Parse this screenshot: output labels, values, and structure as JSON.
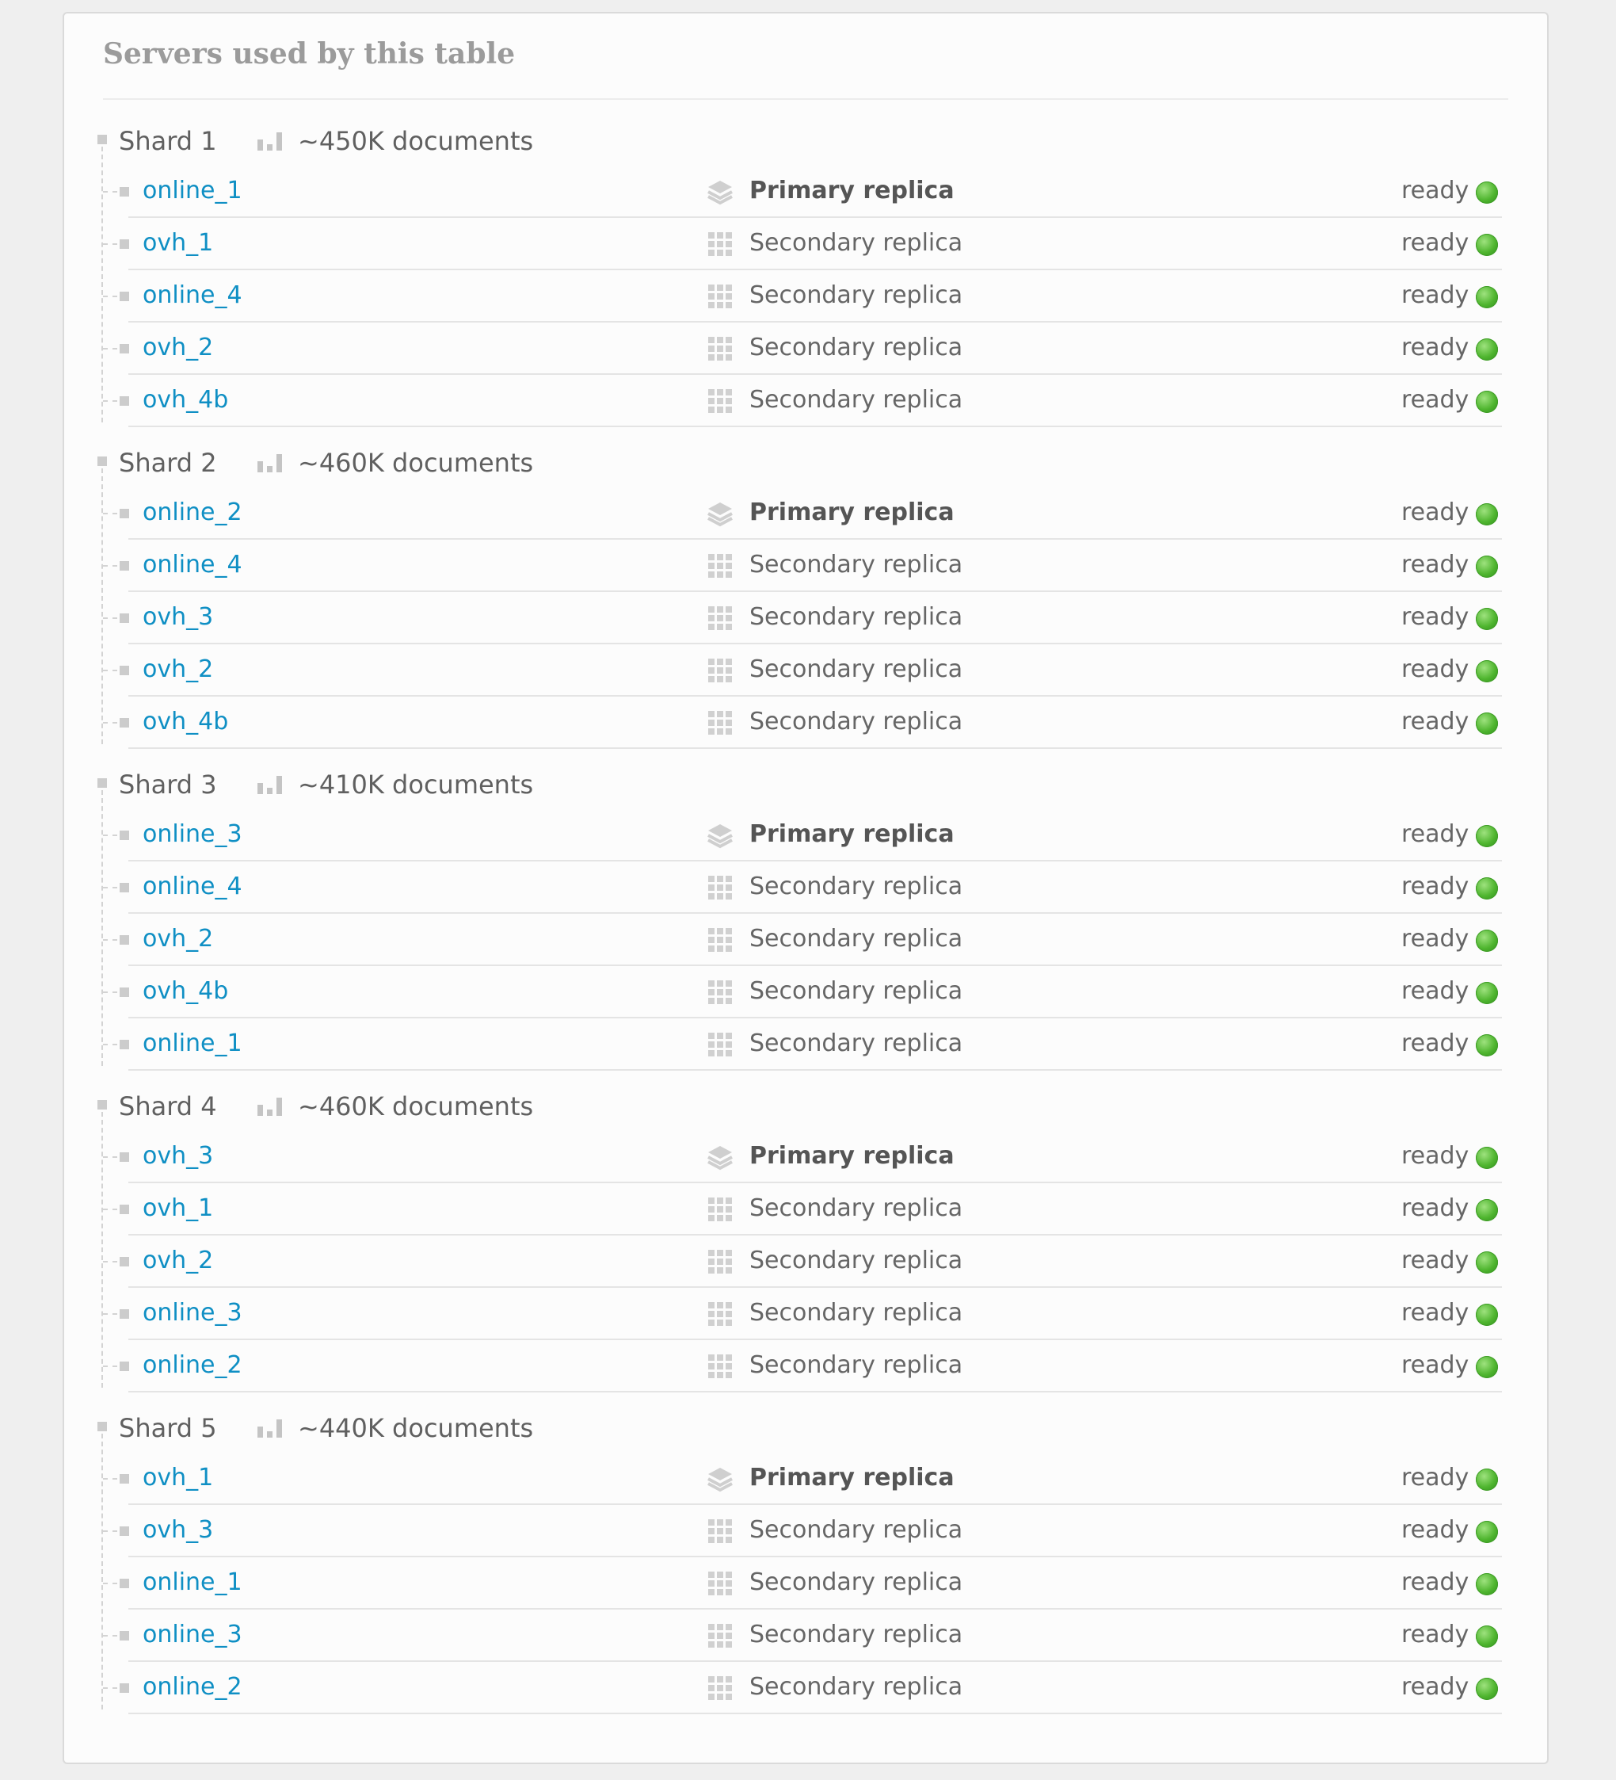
{
  "panel": {
    "title": "Servers used by this table"
  },
  "icons": {
    "shard_stats": "bar-chart-icon",
    "primary_role": "layers-icon",
    "secondary_role": "grid-icon",
    "status": "status-dot-icon"
  },
  "colors": {
    "link": "#0f8fc4",
    "status_ready": "#4fb52f",
    "muted_text": "#606060",
    "icon_grey": "#cccccc"
  },
  "shards": [
    {
      "name": "Shard 1",
      "documents": "~450K documents",
      "replicas": [
        {
          "server": "online_1",
          "role": "Primary replica",
          "primary": true,
          "status": "ready"
        },
        {
          "server": "ovh_1",
          "role": "Secondary replica",
          "primary": false,
          "status": "ready"
        },
        {
          "server": "online_4",
          "role": "Secondary replica",
          "primary": false,
          "status": "ready"
        },
        {
          "server": "ovh_2",
          "role": "Secondary replica",
          "primary": false,
          "status": "ready"
        },
        {
          "server": "ovh_4b",
          "role": "Secondary replica",
          "primary": false,
          "status": "ready"
        }
      ]
    },
    {
      "name": "Shard 2",
      "documents": "~460K documents",
      "replicas": [
        {
          "server": "online_2",
          "role": "Primary replica",
          "primary": true,
          "status": "ready"
        },
        {
          "server": "online_4",
          "role": "Secondary replica",
          "primary": false,
          "status": "ready"
        },
        {
          "server": "ovh_3",
          "role": "Secondary replica",
          "primary": false,
          "status": "ready"
        },
        {
          "server": "ovh_2",
          "role": "Secondary replica",
          "primary": false,
          "status": "ready"
        },
        {
          "server": "ovh_4b",
          "role": "Secondary replica",
          "primary": false,
          "status": "ready"
        }
      ]
    },
    {
      "name": "Shard 3",
      "documents": "~410K documents",
      "replicas": [
        {
          "server": "online_3",
          "role": "Primary replica",
          "primary": true,
          "status": "ready"
        },
        {
          "server": "online_4",
          "role": "Secondary replica",
          "primary": false,
          "status": "ready"
        },
        {
          "server": "ovh_2",
          "role": "Secondary replica",
          "primary": false,
          "status": "ready"
        },
        {
          "server": "ovh_4b",
          "role": "Secondary replica",
          "primary": false,
          "status": "ready"
        },
        {
          "server": "online_1",
          "role": "Secondary replica",
          "primary": false,
          "status": "ready"
        }
      ]
    },
    {
      "name": "Shard 4",
      "documents": "~460K documents",
      "replicas": [
        {
          "server": "ovh_3",
          "role": "Primary replica",
          "primary": true,
          "status": "ready"
        },
        {
          "server": "ovh_1",
          "role": "Secondary replica",
          "primary": false,
          "status": "ready"
        },
        {
          "server": "ovh_2",
          "role": "Secondary replica",
          "primary": false,
          "status": "ready"
        },
        {
          "server": "online_3",
          "role": "Secondary replica",
          "primary": false,
          "status": "ready"
        },
        {
          "server": "online_2",
          "role": "Secondary replica",
          "primary": false,
          "status": "ready"
        }
      ]
    },
    {
      "name": "Shard 5",
      "documents": "~440K documents",
      "replicas": [
        {
          "server": "ovh_1",
          "role": "Primary replica",
          "primary": true,
          "status": "ready"
        },
        {
          "server": "ovh_3",
          "role": "Secondary replica",
          "primary": false,
          "status": "ready"
        },
        {
          "server": "online_1",
          "role": "Secondary replica",
          "primary": false,
          "status": "ready"
        },
        {
          "server": "online_3",
          "role": "Secondary replica",
          "primary": false,
          "status": "ready"
        },
        {
          "server": "online_2",
          "role": "Secondary replica",
          "primary": false,
          "status": "ready"
        }
      ]
    }
  ]
}
